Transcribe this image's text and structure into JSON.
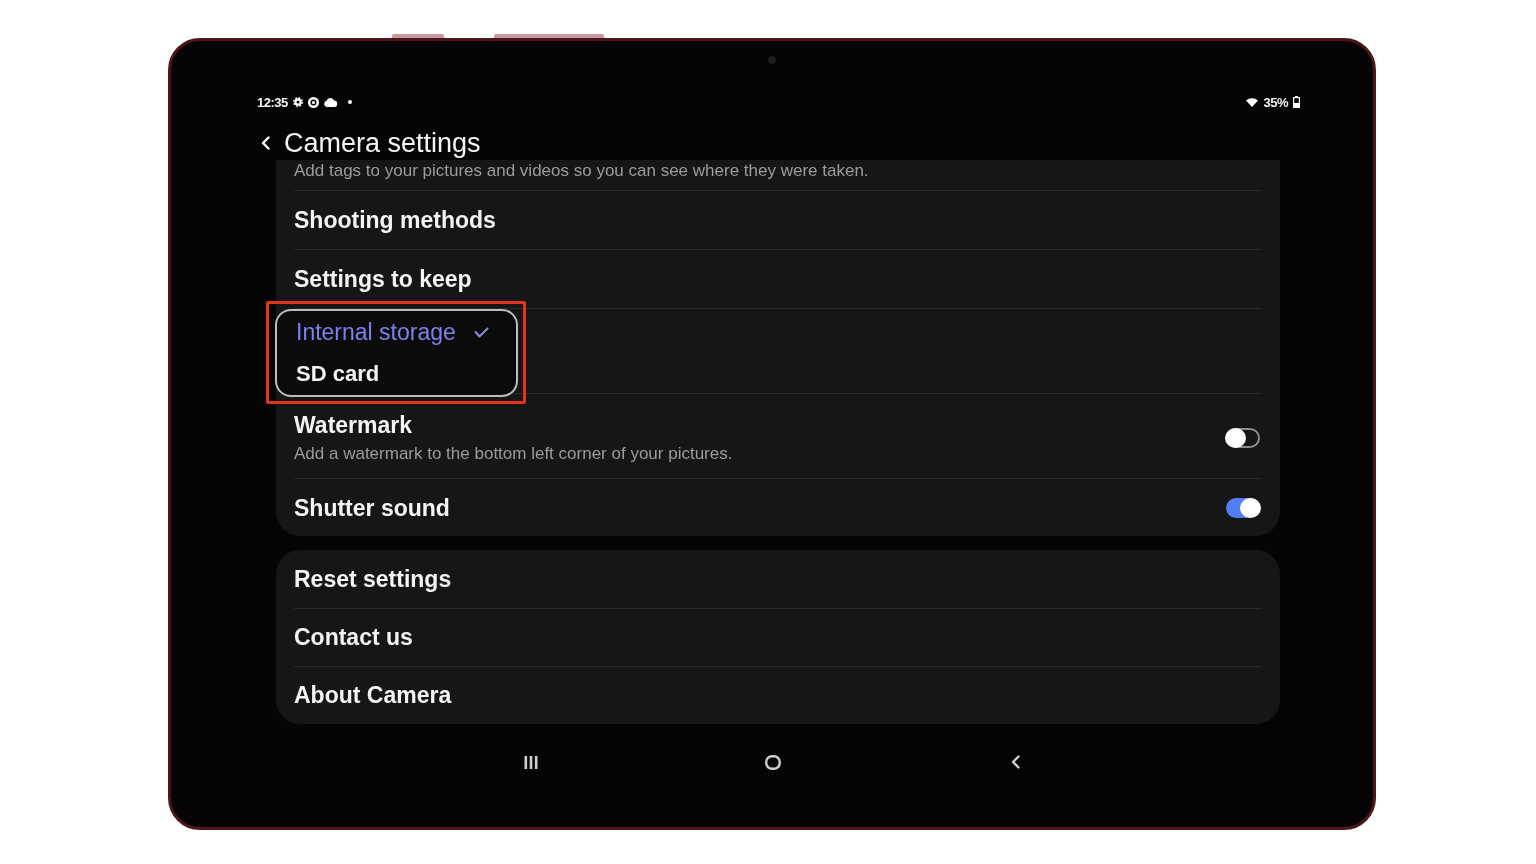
{
  "status_bar": {
    "time": "12:35",
    "battery": "35%"
  },
  "header": {
    "title": "Camera settings"
  },
  "groups": [
    {
      "items": [
        {
          "kind": "note",
          "subtitle": "Add tags to your pictures and videos so you can see where they were taken."
        },
        {
          "kind": "link",
          "title": "Shooting methods"
        },
        {
          "kind": "link",
          "title": "Settings to keep"
        },
        {
          "kind": "dropdown",
          "options": [
            {
              "label": "Internal storage",
              "selected": true
            },
            {
              "label": "SD card",
              "selected": false
            }
          ]
        },
        {
          "kind": "switch",
          "title": "Watermark",
          "subtitle": "Add a watermark to the bottom left corner of your pictures.",
          "on": false
        },
        {
          "kind": "switch",
          "title": "Shutter sound",
          "on": true
        }
      ]
    },
    {
      "items": [
        {
          "kind": "link",
          "title": "Reset settings"
        },
        {
          "kind": "link",
          "title": "Contact us"
        },
        {
          "kind": "link",
          "title": "About Camera"
        }
      ]
    }
  ]
}
